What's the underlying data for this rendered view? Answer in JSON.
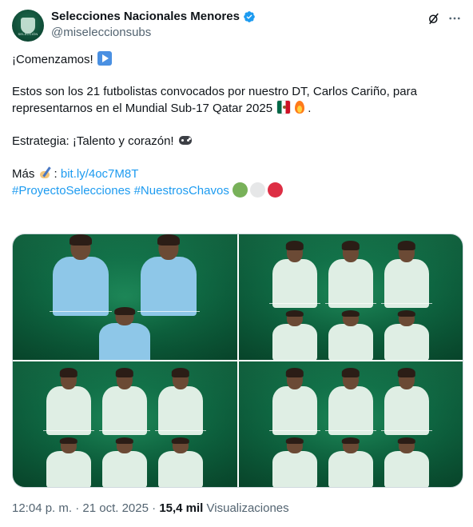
{
  "account": {
    "display_name": "Selecciones Nacionales Menores",
    "handle": "@miseleccionsubs",
    "avatar_text": "SELECCIÓN",
    "verified": true,
    "verified_color": "#1d9bf0"
  },
  "header_icons": [
    "grok-icon",
    "more-icon"
  ],
  "tweet": {
    "line1": "¡Comenzamos!",
    "line2": "Estos son los 21 futbolistas convocados por nuestro DT, Carlos Cariño, para representarnos en el Mundial Sub-17 Qatar 2025",
    "line2_end": ".",
    "line3": "Estrategia: ¡Talento y corazón!",
    "mas_label": "Más",
    "mas_colon": ":",
    "link": "bit.ly/4oc7M8T",
    "hashtag1": "#ProyectoSelecciones",
    "hashtag2": "#NuestrosChavos",
    "circle_colors": [
      "#78b159",
      "#e6e7e8",
      "#dd2e44"
    ]
  },
  "media": {
    "panels": 4,
    "background_color": "#0f6a44"
  },
  "footer": {
    "time": "12:04 p. m.",
    "sep1": "·",
    "date": "21 oct. 2025",
    "sep2": "·",
    "views_count": "15,4 mil",
    "views_label": "Visualizaciones"
  },
  "colors": {
    "text": "#0f1419",
    "secondary": "#536471",
    "link": "#1d9bf0"
  }
}
